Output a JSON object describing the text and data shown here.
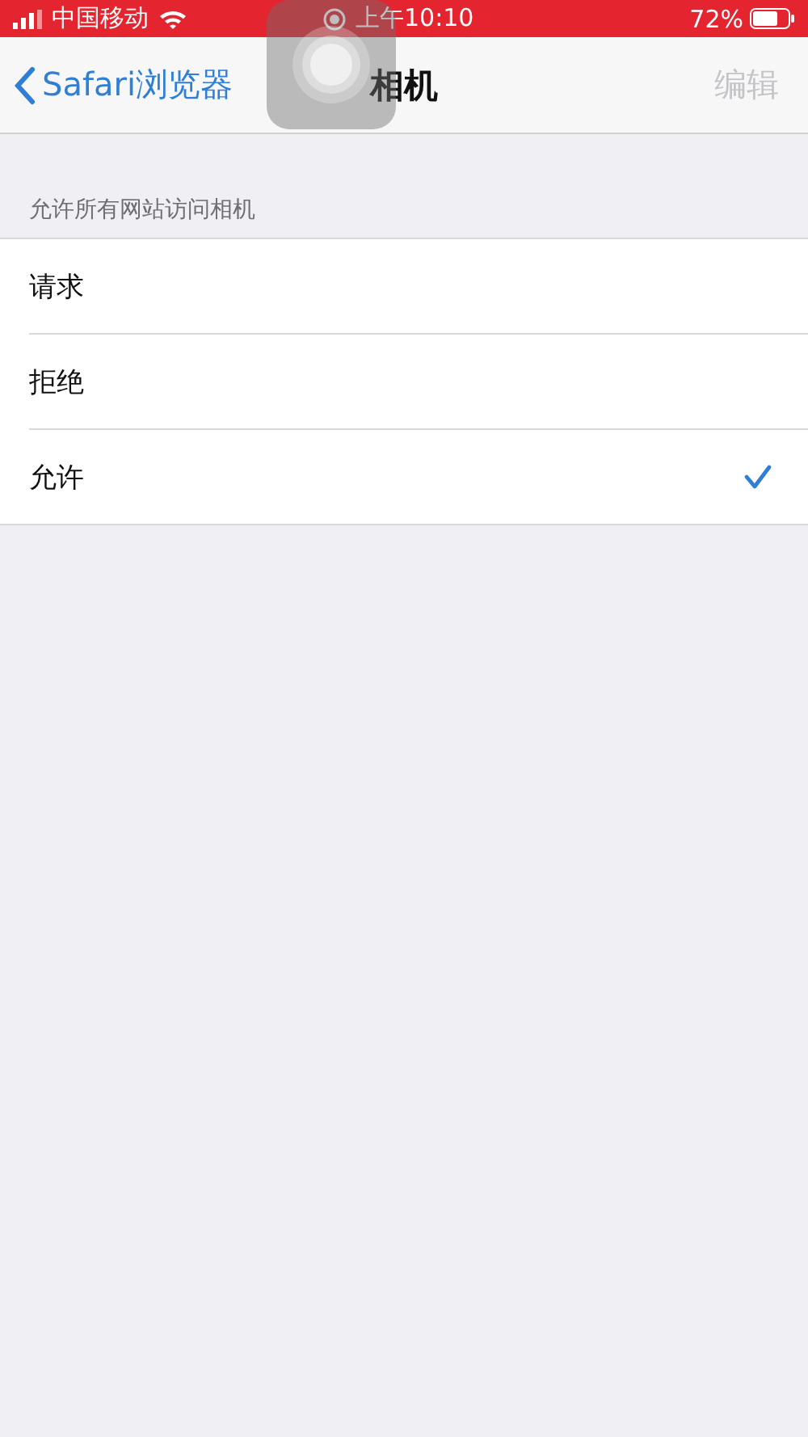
{
  "status_bar": {
    "carrier": "中国移动",
    "time": "上午10:10",
    "battery": "72%"
  },
  "nav": {
    "back": "Safari浏览器",
    "title": "相机",
    "edit": {
      "label": "编辑",
      "disabled": true
    }
  },
  "section": {
    "header": "允许所有网站访问相机",
    "options": [
      {
        "label": "请求",
        "selected": false
      },
      {
        "label": "拒绝",
        "selected": false
      },
      {
        "label": "允许",
        "selected": true
      }
    ]
  }
}
